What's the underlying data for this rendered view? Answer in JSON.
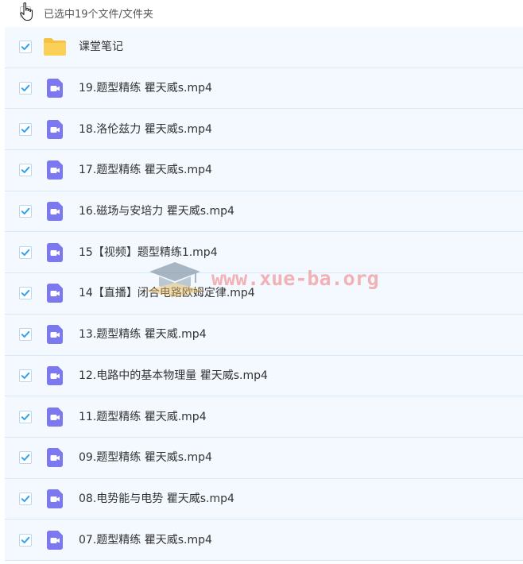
{
  "header": {
    "selection_text": "已选中19个文件/文件夹"
  },
  "colors": {
    "row_bg": "#f3f9ff",
    "row_border": "#d7e9f8",
    "check": "#2ea3ef",
    "video_icon": "#7b78f0",
    "folder_icon": "#fbd057"
  },
  "files": [
    {
      "name": "课堂笔记",
      "type": "folder",
      "checked": true
    },
    {
      "name": "19.题型精练 瞿天威s.mp4",
      "type": "video",
      "checked": true
    },
    {
      "name": "18.洛伦兹力 瞿天威s.mp4",
      "type": "video",
      "checked": true
    },
    {
      "name": "17.题型精练 瞿天威s.mp4",
      "type": "video",
      "checked": true
    },
    {
      "name": "16.磁场与安培力 瞿天威s.mp4",
      "type": "video",
      "checked": true
    },
    {
      "name": "15【视频】题型精练1.mp4",
      "type": "video",
      "checked": true
    },
    {
      "name": "14【直播】闭合电路欧姆定律.mp4",
      "type": "video",
      "checked": true
    },
    {
      "name": "13.题型精练 瞿天威.mp4",
      "type": "video",
      "checked": true
    },
    {
      "name": "12.电路中的基本物理量 瞿天威s.mp4",
      "type": "video",
      "checked": true
    },
    {
      "name": "11.题型精练 瞿天威.mp4",
      "type": "video",
      "checked": true
    },
    {
      "name": "09.题型精练 瞿天威s.mp4",
      "type": "video",
      "checked": true
    },
    {
      "name": "08.电势能与电势 瞿天威s.mp4",
      "type": "video",
      "checked": true
    },
    {
      "name": "07.题型精练 瞿天威s.mp4",
      "type": "video",
      "checked": true
    }
  ],
  "watermark": {
    "text": "www.xue-ba.org",
    "icon": "graduation-cap-icon"
  }
}
